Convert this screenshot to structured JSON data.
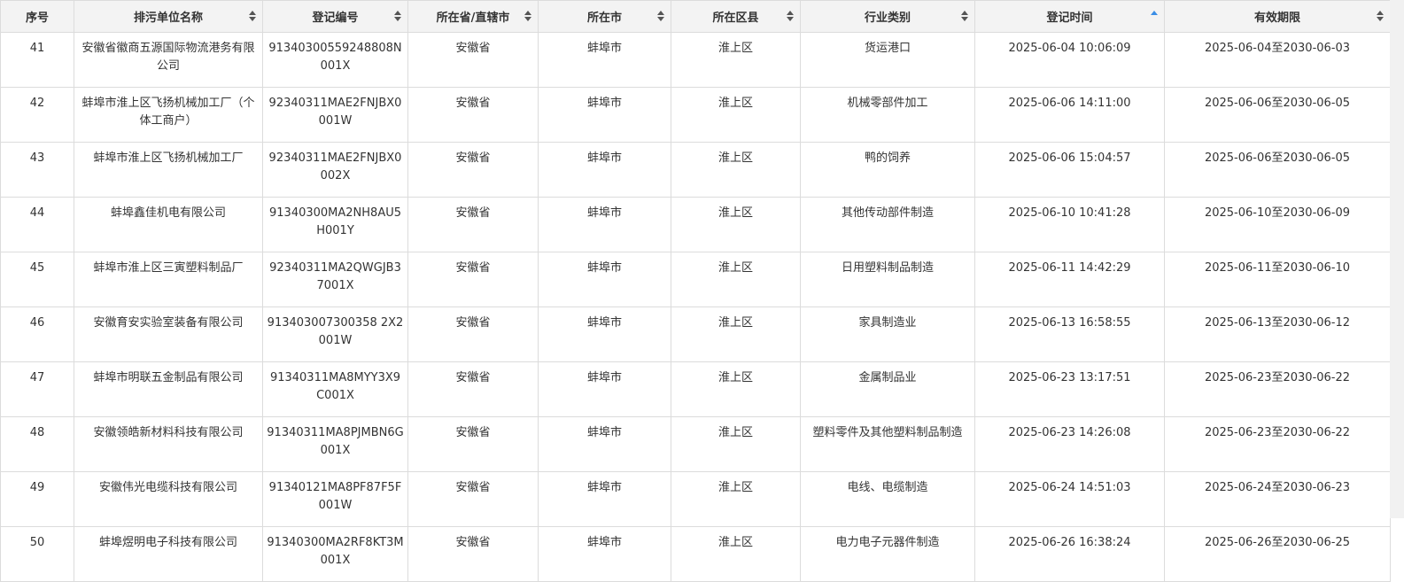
{
  "columns": [
    {
      "label": "序号",
      "sort": "none"
    },
    {
      "label": "排污单位名称",
      "sort": "both"
    },
    {
      "label": "登记编号",
      "sort": "both"
    },
    {
      "label": "所在省/直辖市",
      "sort": "both"
    },
    {
      "label": "所在市",
      "sort": "both"
    },
    {
      "label": "所在区县",
      "sort": "both"
    },
    {
      "label": "行业类别",
      "sort": "both"
    },
    {
      "label": "登记时间",
      "sort": "asc"
    },
    {
      "label": "有效期限",
      "sort": "both"
    }
  ],
  "rows": [
    {
      "no": "41",
      "name": "安徽省徽商五源国际物流港务有限公司",
      "code": "91340300559248808N001X",
      "province": "安徽省",
      "city": "蚌埠市",
      "district": "淮上区",
      "industry": "货运港口",
      "reg_time": "2025-06-04 10:06:09",
      "validity": "2025-06-04至2030-06-03"
    },
    {
      "no": "42",
      "name": "蚌埠市淮上区飞扬机械加工厂（个体工商户）",
      "code": "92340311MAE2FNJBX0001W",
      "province": "安徽省",
      "city": "蚌埠市",
      "district": "淮上区",
      "industry": "机械零部件加工",
      "reg_time": "2025-06-06 14:11:00",
      "validity": "2025-06-06至2030-06-05"
    },
    {
      "no": "43",
      "name": "蚌埠市淮上区飞扬机械加工厂",
      "code": "92340311MAE2FNJBX0002X",
      "province": "安徽省",
      "city": "蚌埠市",
      "district": "淮上区",
      "industry": "鸭的饲养",
      "reg_time": "2025-06-06 15:04:57",
      "validity": "2025-06-06至2030-06-05"
    },
    {
      "no": "44",
      "name": "蚌埠鑫佳机电有限公司",
      "code": "91340300MA2NH8AU5H001Y",
      "province": "安徽省",
      "city": "蚌埠市",
      "district": "淮上区",
      "industry": "其他传动部件制造",
      "reg_time": "2025-06-10 10:41:28",
      "validity": "2025-06-10至2030-06-09"
    },
    {
      "no": "45",
      "name": "蚌埠市淮上区三寅塑料制品厂",
      "code": "92340311MA2QWGJB37001X",
      "province": "安徽省",
      "city": "蚌埠市",
      "district": "淮上区",
      "industry": "日用塑料制品制造",
      "reg_time": "2025-06-11 14:42:29",
      "validity": "2025-06-11至2030-06-10"
    },
    {
      "no": "46",
      "name": "安徽育安实验室装备有限公司",
      "code": "913403007300358 2X2001W",
      "province": "安徽省",
      "city": "蚌埠市",
      "district": "淮上区",
      "industry": "家具制造业",
      "reg_time": "2025-06-13 16:58:55",
      "validity": "2025-06-13至2030-06-12"
    },
    {
      "no": "47",
      "name": "蚌埠市明联五金制品有限公司",
      "code": "91340311MA8MYY3X9C001X",
      "province": "安徽省",
      "city": "蚌埠市",
      "district": "淮上区",
      "industry": "金属制品业",
      "reg_time": "2025-06-23 13:17:51",
      "validity": "2025-06-23至2030-06-22"
    },
    {
      "no": "48",
      "name": "安徽领皓新材料科技有限公司",
      "code": "91340311MA8PJMBN6G001X",
      "province": "安徽省",
      "city": "蚌埠市",
      "district": "淮上区",
      "industry": "塑料零件及其他塑料制品制造",
      "reg_time": "2025-06-23 14:26:08",
      "validity": "2025-06-23至2030-06-22"
    },
    {
      "no": "49",
      "name": "安徽伟光电缆科技有限公司",
      "code": "91340121MA8PF87F5F001W",
      "province": "安徽省",
      "city": "蚌埠市",
      "district": "淮上区",
      "industry": "电线、电缆制造",
      "reg_time": "2025-06-24 14:51:03",
      "validity": "2025-06-24至2030-06-23"
    },
    {
      "no": "50",
      "name": "蚌埠煜明电子科技有限公司",
      "code": "91340300MA2RF8KT3M001X",
      "province": "安徽省",
      "city": "蚌埠市",
      "district": "淮上区",
      "industry": "电力电子元器件制造",
      "reg_time": "2025-06-26 16:38:24",
      "validity": "2025-06-26至2030-06-25"
    }
  ]
}
